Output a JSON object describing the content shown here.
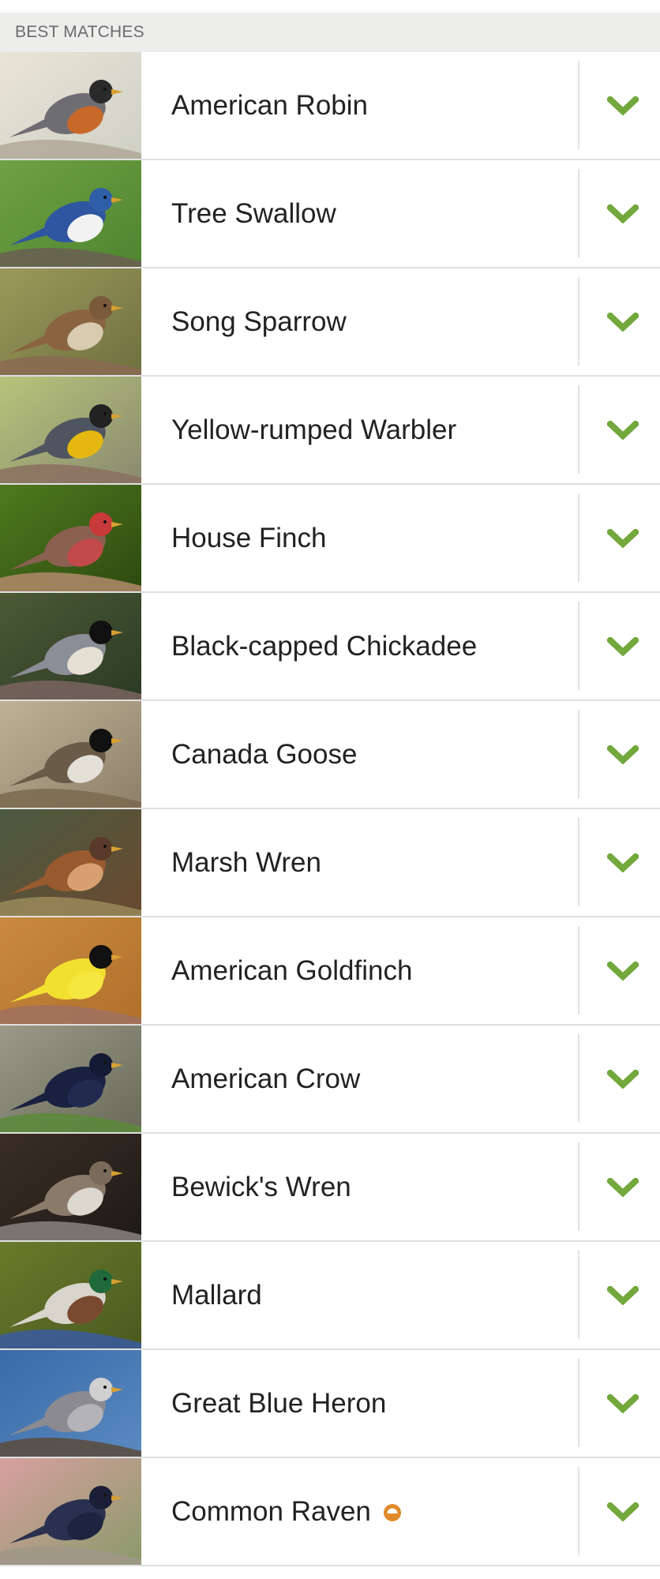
{
  "section": {
    "title": "BEST MATCHES"
  },
  "colors": {
    "accent_green": "#72a83c",
    "badge_orange": "#e08a2c",
    "header_bg": "#edeeec",
    "divider": "#e0e0e0"
  },
  "birds": [
    {
      "name": "American Robin",
      "icon": "chevron-down-icon",
      "photo": {
        "bg1": "#e9e4d8",
        "bg2": "#cfd0c4",
        "body": "#6e6e72",
        "belly": "#c8692a",
        "head": "#2a2a2a",
        "perch": "#b0a898"
      }
    },
    {
      "name": "Tree Swallow",
      "icon": "chevron-down-icon",
      "photo": {
        "bg1": "#6fa144",
        "bg2": "#4f8530",
        "body": "#2f56a0",
        "belly": "#f2f2f2",
        "head": "#2f5fa8",
        "perch": "#6a5e52"
      }
    },
    {
      "name": "Song Sparrow",
      "icon": "chevron-down-icon",
      "photo": {
        "bg1": "#9a9a5a",
        "bg2": "#6f7040",
        "body": "#8a6440",
        "belly": "#d8cbb0",
        "head": "#7a5a3a",
        "perch": "#8a6a52"
      }
    },
    {
      "name": "Yellow-rumped Warbler",
      "icon": "chevron-down-icon",
      "photo": {
        "bg1": "#b7c47a",
        "bg2": "#8a8a70",
        "body": "#4e5560",
        "belly": "#e4b810",
        "head": "#222222",
        "perch": "#8a7060"
      }
    },
    {
      "name": "House Finch",
      "icon": "chevron-down-icon",
      "photo": {
        "bg1": "#4e7a1e",
        "bg2": "#2e4a10",
        "body": "#8a6050",
        "belly": "#c24a4a",
        "head": "#c83a3a",
        "perch": "#b08a6a"
      }
    },
    {
      "name": "Black-capped Chickadee",
      "icon": "chevron-down-icon",
      "photo": {
        "bg1": "#4b5a36",
        "bg2": "#2c3a24",
        "body": "#8a8e96",
        "belly": "#e6e0d4",
        "head": "#111111",
        "perch": "#7a6460"
      }
    },
    {
      "name": "Canada Goose",
      "icon": "chevron-down-icon",
      "photo": {
        "bg1": "#bdb298",
        "bg2": "#8e8068",
        "body": "#6a5a48",
        "belly": "#e4e0d8",
        "head": "#111111",
        "perch": "#7a6a50"
      }
    },
    {
      "name": "Marsh Wren",
      "icon": "chevron-down-icon",
      "photo": {
        "bg1": "#4a5a40",
        "bg2": "#6a4a30",
        "body": "#9a5a30",
        "belly": "#d8a070",
        "head": "#5a3a2a",
        "perch": "#9a8a5a"
      }
    },
    {
      "name": "American Goldfinch",
      "icon": "chevron-down-icon",
      "photo": {
        "bg1": "#c98a40",
        "bg2": "#b0702a",
        "body": "#f2e030",
        "belly": "#f6e640",
        "head": "#111111",
        "perch": "#a07060"
      }
    },
    {
      "name": "American Crow",
      "icon": "chevron-down-icon",
      "photo": {
        "bg1": "#9a9a88",
        "bg2": "#6a6a58",
        "body": "#1a2040",
        "belly": "#222a50",
        "head": "#141a34",
        "perch": "#5a8a3a"
      }
    },
    {
      "name": "Bewick's Wren",
      "icon": "chevron-down-icon",
      "photo": {
        "bg1": "#3a2e26",
        "bg2": "#1e1a16",
        "body": "#8a7a6a",
        "belly": "#dcd8d0",
        "head": "#7a6a5a",
        "perch": "#8a8480"
      }
    },
    {
      "name": "Mallard",
      "icon": "chevron-down-icon",
      "photo": {
        "bg1": "#6a7a2a",
        "bg2": "#4a5a20",
        "body": "#d8d4cc",
        "belly": "#7a4a30",
        "head": "#1e6a3a",
        "perch": "#3a5aa0"
      }
    },
    {
      "name": "Great Blue Heron",
      "icon": "chevron-down-icon",
      "photo": {
        "bg1": "#3a6aa8",
        "bg2": "#5a8ac0",
        "body": "#8a8a90",
        "belly": "#b4b4b8",
        "head": "#d0d0d0",
        "perch": "#5a4a3a"
      }
    },
    {
      "name": "Common Raven",
      "icon": "chevron-down-icon",
      "badge": "partial-season-badge-icon",
      "photo": {
        "bg1": "#d8a0a0",
        "bg2": "#8a9a6a",
        "body": "#2a3050",
        "belly": "#1e2440",
        "head": "#1a1e36",
        "perch": "#a09888"
      }
    }
  ]
}
